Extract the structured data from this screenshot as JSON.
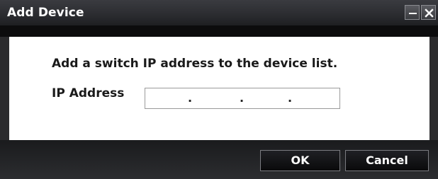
{
  "window": {
    "title": "Add Device",
    "minimize_icon": "minimize-icon",
    "close_icon": "close-icon"
  },
  "content": {
    "instruction": "Add a switch IP address to the device list.",
    "ip_label": "IP Address",
    "ip_value": "",
    "ip_separator": "."
  },
  "buttons": {
    "ok_label": "OK",
    "cancel_label": "Cancel"
  },
  "colors": {
    "chrome": "#2b2b2d",
    "panel": "#ffffff",
    "button_text": "#ffffff"
  }
}
